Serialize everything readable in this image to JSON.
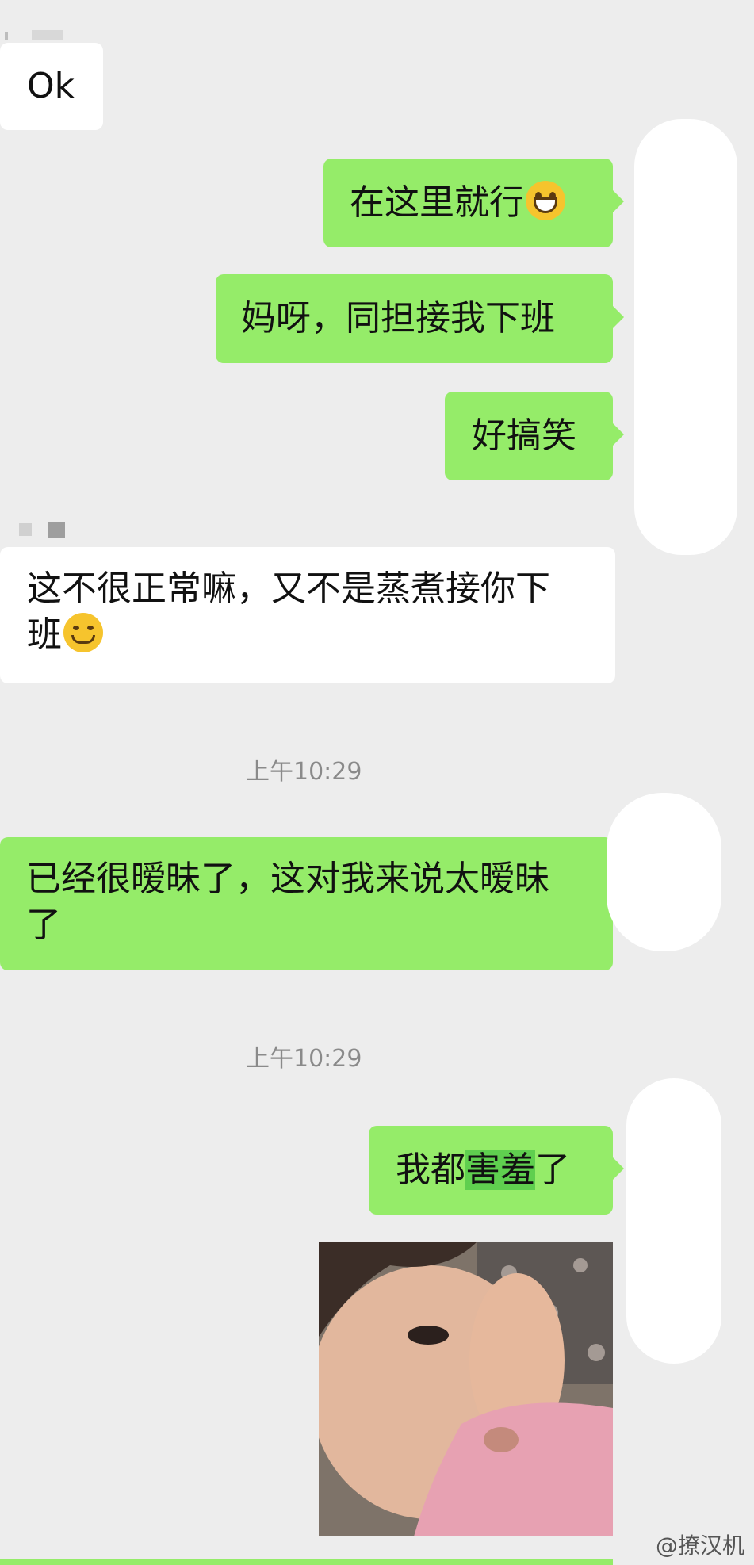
{
  "messages": {
    "m1": "Ok",
    "m2": "在这里就行",
    "m3": "妈呀，同担接我下班",
    "m4": "好搞笑",
    "m5_line1": "这不很正常嘛，又不是蒸煮接你下",
    "m5_line2": "班",
    "ts1": "上午10:29",
    "m6_line1": "已经很暧昧了，这对我来说太暧昧",
    "m6_line2": "了",
    "ts2": "上午10:29",
    "m7_a": "我都",
    "m7_b": "害羞",
    "m7_c": "了"
  },
  "icons": {
    "grin": "grin-emoji-icon",
    "smirk": "smirk-emoji-icon"
  },
  "watermark": "@撩汉机",
  "colors": {
    "background": "#ededed",
    "incoming_bubble": "#ffffff",
    "outgoing_bubble": "#95ec69",
    "timestamp": "#8a8a8a"
  }
}
